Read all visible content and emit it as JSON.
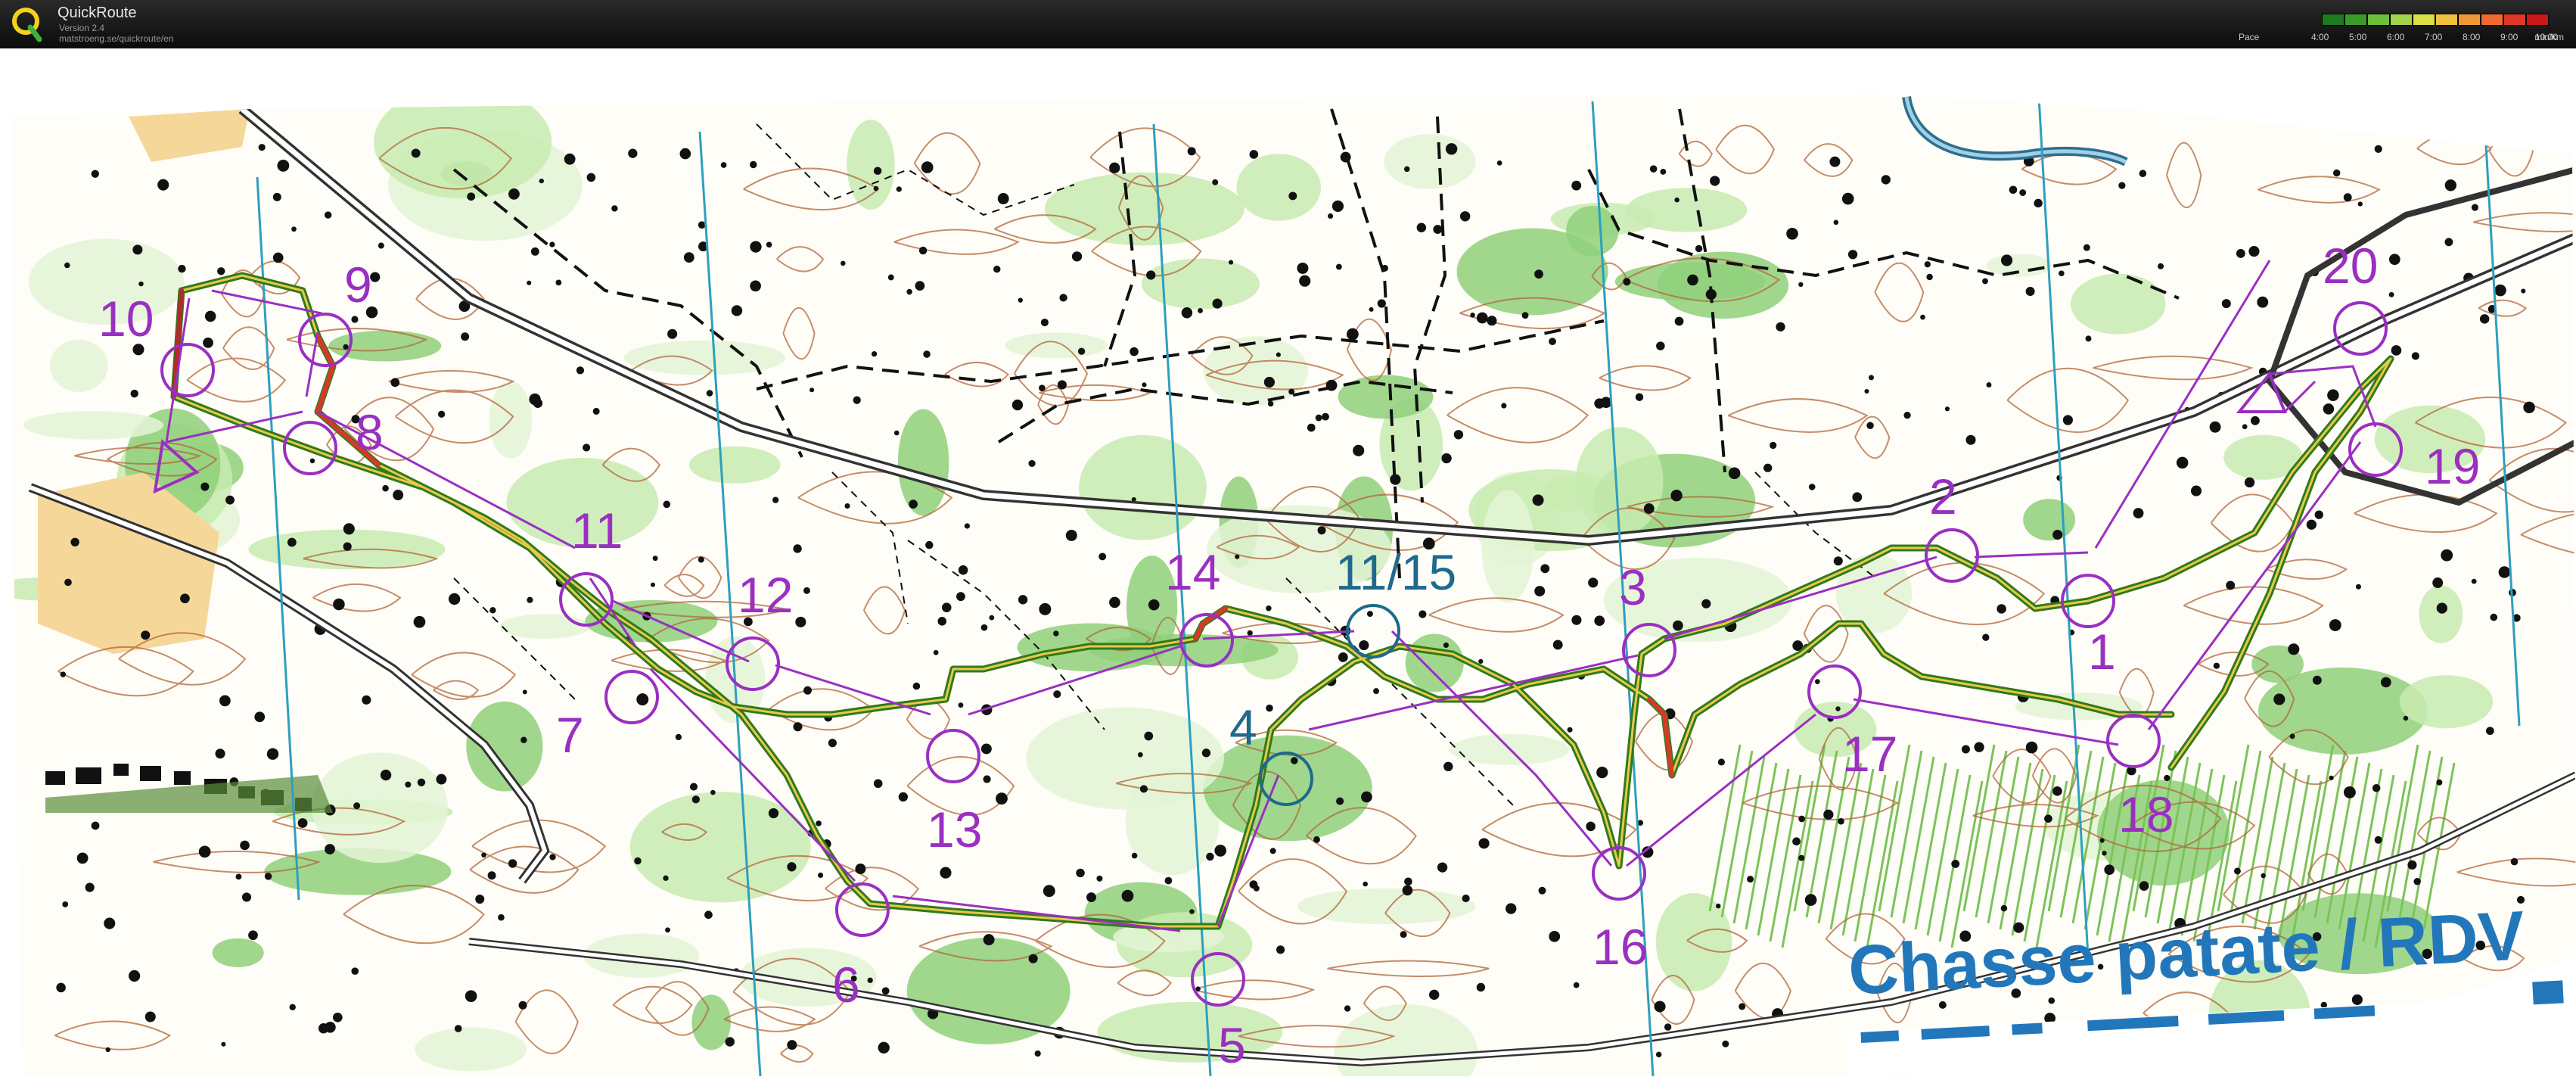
{
  "app": {
    "title": "QuickRoute",
    "version": "Version 2.4",
    "url": "matstroeng.se/quickroute/en"
  },
  "pace_legend": {
    "label": "Pace",
    "ticks": [
      "4:00",
      "5:00",
      "6:00",
      "7:00",
      "8:00",
      "9:00",
      "10:00"
    ],
    "unit": "min/km",
    "colors": [
      "#1e7a1e",
      "#3a9b2a",
      "#6cbf3a",
      "#a4d24a",
      "#d8e048",
      "#f0c040",
      "#f09838",
      "#ee6a30",
      "#e03828",
      "#c81818"
    ]
  },
  "map": {
    "banner_text": "Chasse patate / RDV",
    "controls": [
      {
        "label": "1"
      },
      {
        "label": "2"
      },
      {
        "label": "3"
      },
      {
        "label": "4"
      },
      {
        "label": "5"
      },
      {
        "label": "6"
      },
      {
        "label": "7"
      },
      {
        "label": "8"
      },
      {
        "label": "9"
      },
      {
        "label": "10"
      },
      {
        "label": "11"
      },
      {
        "label": "12"
      },
      {
        "label": "13"
      },
      {
        "label": "14"
      },
      {
        "label": "11/15"
      },
      {
        "label": "16"
      },
      {
        "label": "17"
      },
      {
        "label": "18"
      },
      {
        "label": "19"
      },
      {
        "label": "20"
      }
    ],
    "colors": {
      "course": "#9a2fc2",
      "control_alt": "#1e6a8c",
      "magnetic_north": "#2e9fbf",
      "vegetation": "#c8ebb0",
      "vegetation_dark": "#8fd07a",
      "open_land": "#f6d79a",
      "contour": "#b2673a",
      "route_green": "#2f7a1c",
      "route_red": "#d43a28",
      "banner": "#2277bb"
    }
  }
}
